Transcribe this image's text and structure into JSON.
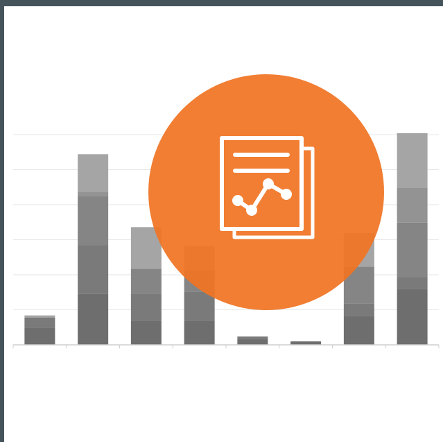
{
  "colors": {
    "frame": "#45535b",
    "background": "#ffffff",
    "gridline": "#e6e6e6",
    "axis": "#cfcfcf",
    "accent": "#f07423",
    "icon": "#ffffff",
    "segment_shades": [
      "#6e6e6e",
      "#7a7a7a",
      "#858585",
      "#939393",
      "#a5a5a5",
      "#bdbdbd"
    ]
  },
  "chart_data": {
    "type": "bar",
    "stacked": true,
    "categories_count": 8,
    "ylim": [
      0,
      6
    ],
    "grid": true,
    "stacks": [
      [
        0.5,
        0.28,
        0.06
      ],
      [
        1.45,
        1.4,
        1.4,
        0.12,
        1.07
      ],
      [
        0.7,
        0.77,
        0.7,
        1.19
      ],
      [
        0.7,
        0.82,
        0.6,
        0.7
      ],
      [
        0.16,
        0.08
      ],
      [
        0.1
      ],
      [
        0.82,
        0.35,
        1.06,
        0.96
      ],
      [
        1.6,
        0.33,
        1.56,
        1.0,
        1.55
      ]
    ]
  },
  "icon": {
    "name": "report-analytics-icon"
  }
}
